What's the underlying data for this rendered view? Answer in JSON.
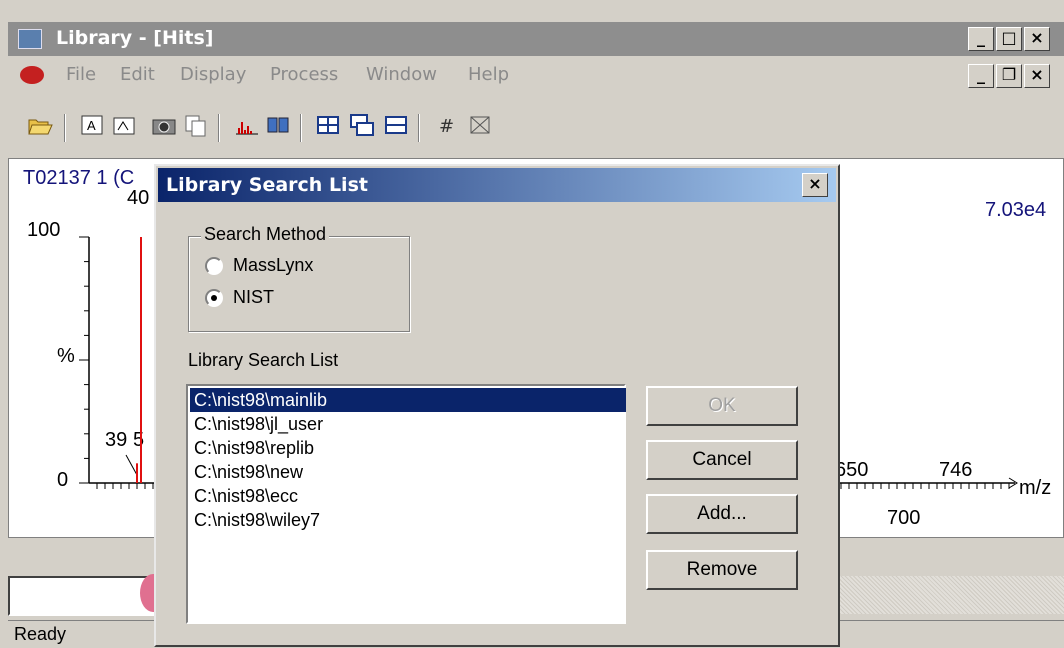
{
  "window": {
    "title": "Library - [Hits]"
  },
  "menu": [
    "File",
    "Edit",
    "Display",
    "Process",
    "Window",
    "Help"
  ],
  "toolbar_icons": [
    "open-folder-icon",
    "print-spectrum-icon",
    "print-list-icon",
    "camera-icon",
    "copy-icon",
    "spectrum-bars-icon",
    "book-icon",
    "tile-icon",
    "cascade-icon",
    "stack-icon",
    "hash-icon",
    "zoom-fit-icon"
  ],
  "chart": {
    "sample_label": "T02137 1 (C",
    "intensity_label": "7.03e4",
    "y_ticks": {
      "top": "100",
      "mid": "%",
      "bottom": "0"
    },
    "peaks": [
      {
        "label": "40",
        "x": 40,
        "y": 100
      },
      {
        "label": "39",
        "x": 39,
        "y": 8
      }
    ],
    "peak_label_5": "5",
    "x_labels": {
      "a": "650",
      "b": "746",
      "c": "700"
    },
    "x_unit": "m/z"
  },
  "status": {
    "text": "Ready"
  },
  "dialog": {
    "title": "Library Search List",
    "search_method_label": "Search Method",
    "options": [
      "MassLynx",
      "NIST"
    ],
    "selected_option": "NIST",
    "list_label": "Library Search List",
    "list_items": [
      "C:\\nist98\\mainlib",
      "C:\\nist98\\jl_user",
      "C:\\nist98\\replib",
      "C:\\nist98\\new",
      "C:\\nist98\\ecc",
      "C:\\nist98\\wiley7"
    ],
    "selected_index": 0,
    "buttons": {
      "ok": "OK",
      "cancel": "Cancel",
      "add": "Add...",
      "remove": "Remove"
    }
  }
}
